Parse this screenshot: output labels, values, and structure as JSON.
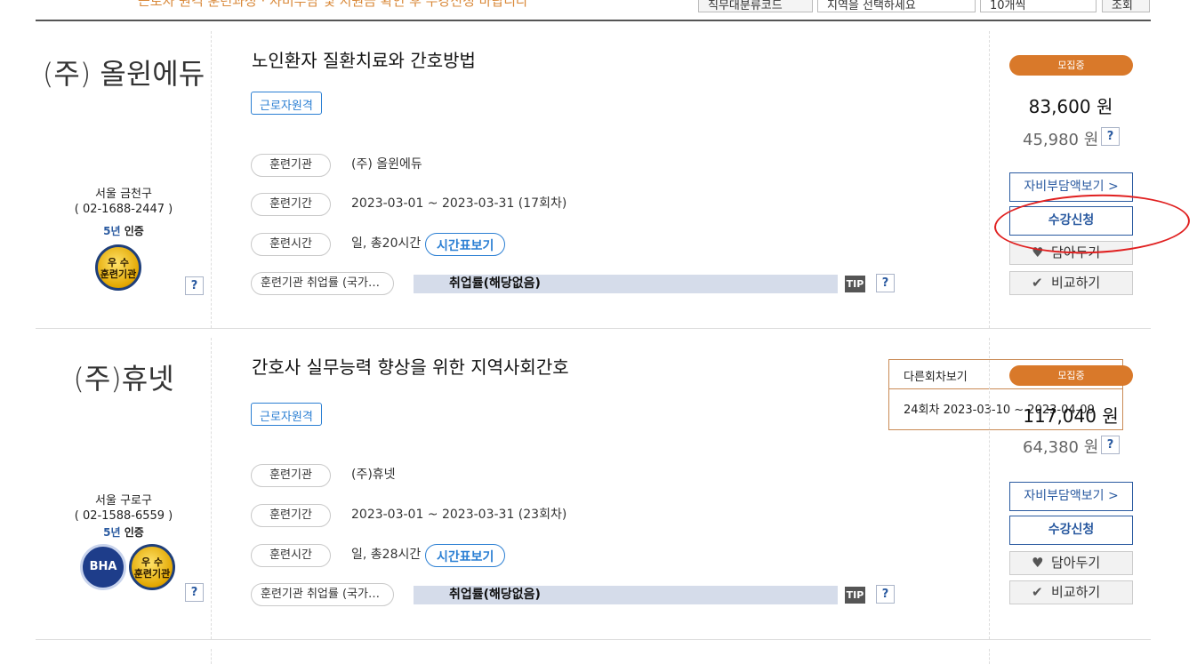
{
  "top": {
    "note": "근로자 원격 훈련과정 · 자비부담 및 지원금 확인 후 수강신청 바랍니다",
    "controls": [
      "직무대분류코드",
      "지역을 선택하세요",
      "10개씩",
      "조회"
    ]
  },
  "courses": [
    {
      "org_name": "(주) 올윈에듀",
      "region": "서울 금천구",
      "phone": "( 02-1688-2447 )",
      "cert_years": "5년",
      "cert_label": " 인증",
      "badge_text": "우 수\n훈련기관",
      "title": "노인환자 질환치료와 간호방법",
      "tag": "근로자원격",
      "rows": {
        "org_label": "훈련기관",
        "org_value": "(주) 올윈에듀",
        "period_label": "훈련기간",
        "period_value": "2023-03-01 ~ 2023-03-31 (17회차)",
        "time_label": "훈련시간",
        "time_value": "일, 총20시간",
        "time_button": "시간표보기",
        "emp_label": "훈련기관 취업률 (국가…",
        "emp_value": "취업률(해당없음)"
      },
      "tip": "TIP",
      "status": "모집중",
      "price": "83,600 원",
      "price_self": "45,980 원",
      "btn_self_pay": "자비부담액보기 >",
      "btn_apply": "수강신청",
      "btn_wish": "담아두기",
      "btn_compare": "비교하기"
    },
    {
      "org_name": "(주)휴넷",
      "region": "서울 구로구",
      "phone": "( 02-1588-6559 )",
      "cert_years": "5년",
      "cert_label": " 인증",
      "badge_bha": "BHA",
      "badge_text": "우 수\n훈련기관",
      "title": "간호사 실무능력 향상을 위한 지역사회간호",
      "tag": "근로자원격",
      "dropdown": {
        "label": "다른회차보기",
        "option": "24회차 2023-03-10 ~ 2023-04-09"
      },
      "rows": {
        "org_label": "훈련기관",
        "org_value": "(주)휴넷",
        "period_label": "훈련기간",
        "period_value": "2023-03-01 ~ 2023-03-31 (23회차)",
        "time_label": "훈련시간",
        "time_value": "일, 총28시간",
        "time_button": "시간표보기",
        "emp_label": "훈련기관 취업률 (국가…",
        "emp_value": "취업률(해당없음)"
      },
      "tip": "TIP",
      "status": "모집중",
      "price": "117,040 원",
      "price_self": "64,380 원",
      "btn_self_pay": "자비부담액보기 >",
      "btn_apply": "수강신청",
      "btn_wish": "담아두기",
      "btn_compare": "비교하기"
    }
  ],
  "qmark": "?",
  "icons": {
    "heart": "heart-icon",
    "check": "check-icon",
    "chevron": "chevron-down-icon"
  },
  "colors": {
    "accent": "#2b7fd3",
    "status": "#d9792a",
    "annotation": "#e02020"
  }
}
